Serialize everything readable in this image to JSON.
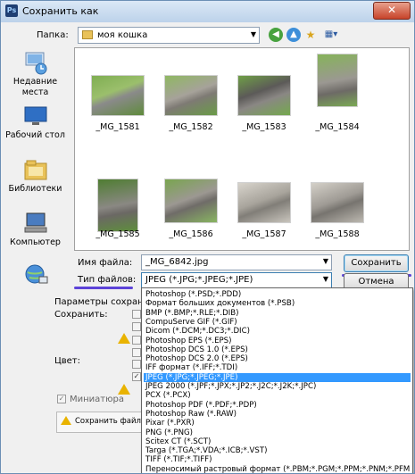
{
  "window": {
    "title": "Сохранить как",
    "app_icon": "Ps",
    "close_label": "✕"
  },
  "folder_bar": {
    "label": "Папка:",
    "current_folder": "моя кошка"
  },
  "places": [
    {
      "label": "Недавние места",
      "icon": "recent-places-icon"
    },
    {
      "label": "Рабочий стол",
      "icon": "desktop-icon"
    },
    {
      "label": "Библиотеки",
      "icon": "libraries-icon"
    },
    {
      "label": "Компьютер",
      "icon": "computer-icon"
    },
    {
      "label": "",
      "icon": "network-icon"
    }
  ],
  "files": [
    {
      "name": "_MG_1581"
    },
    {
      "name": "_MG_1582"
    },
    {
      "name": "_MG_1583"
    },
    {
      "name": "_MG_1584"
    },
    {
      "name": "_MG_1585"
    },
    {
      "name": "_MG_1586"
    },
    {
      "name": "_MG_1587"
    },
    {
      "name": "_MG_1588"
    }
  ],
  "filename": {
    "label": "Имя файла:",
    "value": "_MG_6842.jpg"
  },
  "filetype": {
    "label": "Тип файлов:",
    "value": "JPEG (*.JPG;*.JPEG;*.JPE)"
  },
  "buttons": {
    "save": "Сохранить",
    "cancel": "Отмена"
  },
  "options": {
    "params_label": "Параметры сохранения",
    "save_label": "Сохранить:",
    "color_label": "Цвет:",
    "thumbnail_label": "Миниатюра",
    "bottom_note": "Сохранить файл с"
  },
  "filetype_options": [
    "Photoshop (*.PSD;*.PDD)",
    "Формат больших документов (*.PSB)",
    "BMP (*.BMP;*.RLE;*.DIB)",
    "CompuServe GIF (*.GIF)",
    "Dicom (*.DCM;*.DC3;*.DIC)",
    "Photoshop EPS (*.EPS)",
    "Photoshop DCS 1.0 (*.EPS)",
    "Photoshop DCS 2.0 (*.EPS)",
    "IFF формат (*.IFF;*.TDI)",
    "JPEG (*.JPG;*.JPEG;*.JPE)",
    "JPEG 2000 (*.JPF;*.JPX;*.JP2;*.J2C;*.J2K;*.JPC)",
    "PCX (*.PCX)",
    "Photoshop PDF (*.PDF;*.PDP)",
    "Photoshop Raw (*.RAW)",
    "Pixar (*.PXR)",
    "PNG (*.PNG)",
    "Scitex CT (*.SCT)",
    "Targa (*.TGA;*.VDA;*.ICB;*.VST)",
    "TIFF (*.TIF;*.TIFF)",
    "Переносимый растровый формат (*.PBM;*.PGM;*.PPM;*.PNM;*.PFM;*.PAM)"
  ],
  "selected_filetype_index": 9,
  "colors": {
    "selection": "#3399ff",
    "annotation": "#5d43d8",
    "warning": "#e9b300"
  }
}
